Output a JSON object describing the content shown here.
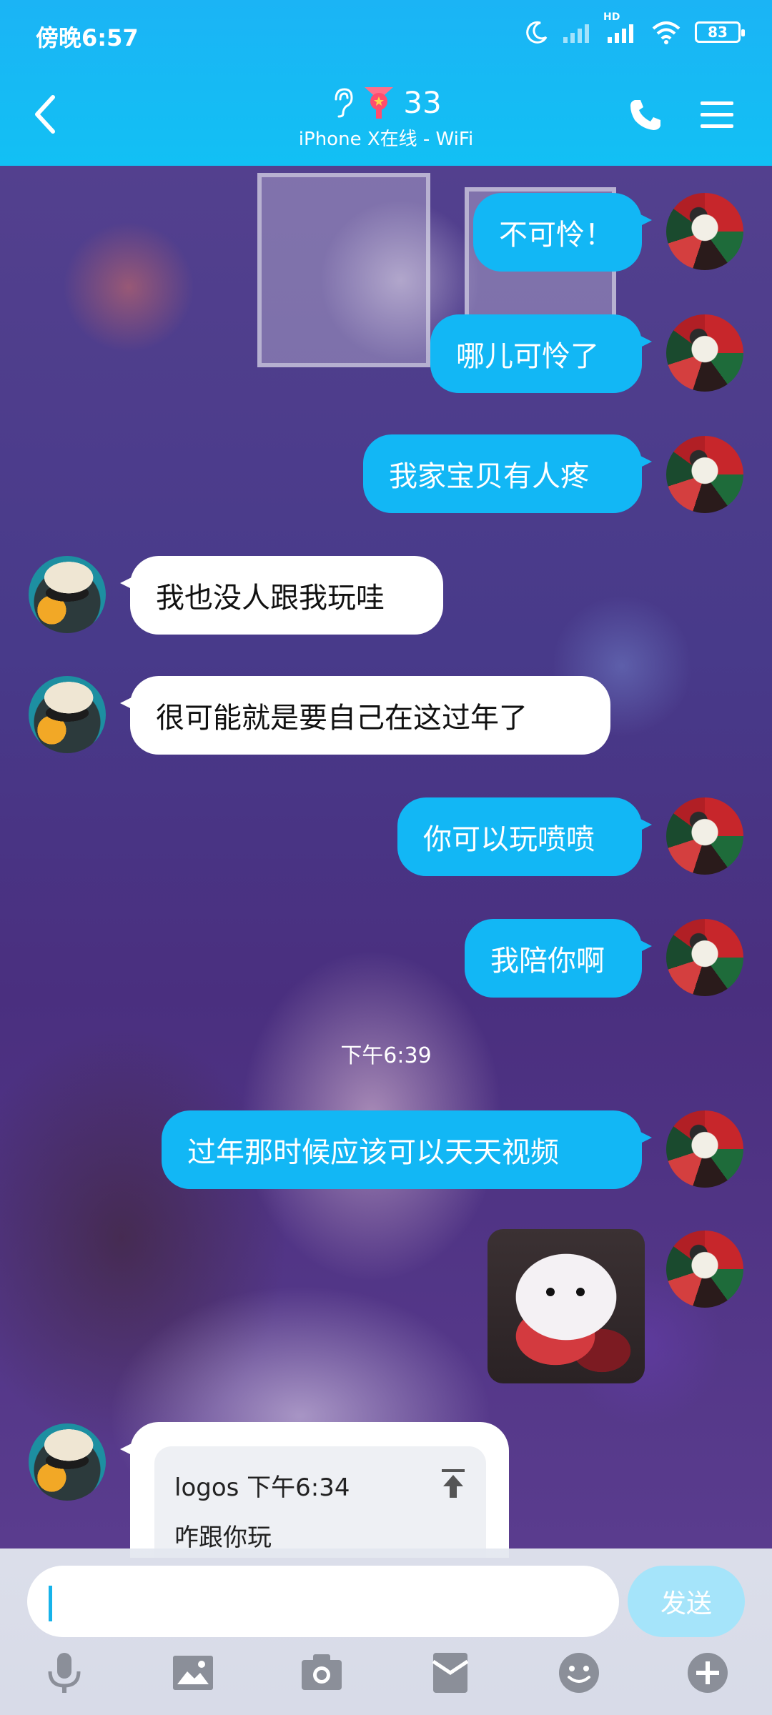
{
  "status_bar": {
    "time": "傍晚6:57",
    "network_hd": "HD",
    "battery": "83"
  },
  "header": {
    "title": "33",
    "subtitle": "iPhone X在线 - WiFi"
  },
  "messages": [
    {
      "side": "out",
      "text": "不可怜！"
    },
    {
      "side": "out",
      "text": "哪儿可怜了"
    },
    {
      "side": "out",
      "text": "我家宝贝有人疼"
    },
    {
      "side": "in",
      "text": "我也没人跟我玩哇"
    },
    {
      "side": "in",
      "text": "很可能就是要自己在这过年了"
    },
    {
      "side": "out",
      "text": "你可以玩喷喷"
    },
    {
      "side": "out",
      "text": "我陪你啊"
    },
    {
      "side": "out",
      "text": "过年那时候应该可以天天视频"
    }
  ],
  "timestamp": "下午6:39",
  "reply": {
    "quote_header": "logos 下午6:34",
    "quote_text": "咋跟你玩"
  },
  "input": {
    "value": "",
    "send_label": "发送"
  },
  "toolbar": [
    "mic-icon",
    "image-icon",
    "camera-icon",
    "red-packet-icon",
    "emoji-icon",
    "plus-icon"
  ],
  "colors": {
    "header": "#12b7f5",
    "bubble_out": "#12b7f5",
    "bubble_in": "#ffffff",
    "send_disabled": "#a5e4fa"
  }
}
